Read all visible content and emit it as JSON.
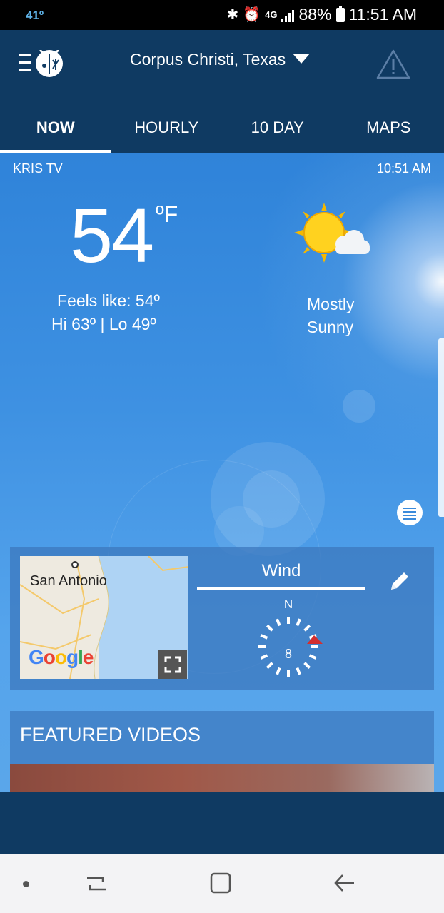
{
  "status_bar": {
    "temperature": "41º",
    "network": "4G",
    "battery": "88%",
    "time": "11:51 AM"
  },
  "header": {
    "location": "Corpus Christi, Texas"
  },
  "tabs": [
    {
      "label": "NOW",
      "active": true
    },
    {
      "label": "HOURLY",
      "active": false
    },
    {
      "label": "10 DAY",
      "active": false
    },
    {
      "label": "MAPS",
      "active": false
    }
  ],
  "current": {
    "source": "KRIS TV",
    "time": "10:51 AM",
    "temperature": "54",
    "unit": "ºF",
    "feels_like": "Feels like: 54º",
    "hi_lo": "Hi 63º | Lo 49º",
    "condition_line1": "Mostly",
    "condition_line2": "Sunny",
    "condition_icon": "mostly-sunny-icon"
  },
  "map_card": {
    "city_label": "San Antonio",
    "map_logo": "Google",
    "wind_title": "Wind",
    "compass_direction": "N",
    "wind_speed": "8"
  },
  "featured": {
    "title": "FEATURED VIDEOS"
  },
  "colors": {
    "header_bg": "#0f3a62",
    "sky_top": "#2f83d9",
    "sky_bottom": "#5aa6ea",
    "wind_arrow": "#d32f2f",
    "status_temp": "#5fb3e8"
  }
}
